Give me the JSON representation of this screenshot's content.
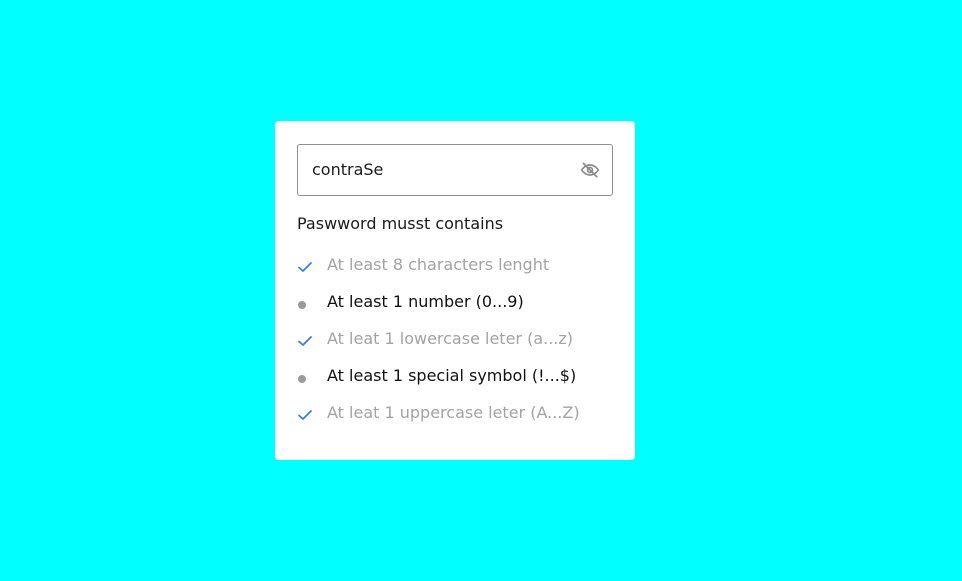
{
  "colors": {
    "background": "#00FFFF",
    "card": "#FFFFFF",
    "check": "#3B7DE8",
    "met_text": "#A3A3A3",
    "unmet_text": "#111111",
    "bullet": "#9A9A9A"
  },
  "password": {
    "value": "contraSe",
    "visibility_icon": "eye-off-icon"
  },
  "requirements": {
    "title": "Paswword musst contains",
    "items": [
      {
        "label": "At least 8 characters lenght",
        "met": true,
        "icon": "check-icon"
      },
      {
        "label": "At least 1 number (0...9)",
        "met": false,
        "icon": "bullet-icon"
      },
      {
        "label": "At leat 1 lowercase leter (a...z)",
        "met": true,
        "icon": "check-icon"
      },
      {
        "label": "At least 1 special symbol (!...$)",
        "met": false,
        "icon": "bullet-icon"
      },
      {
        "label": "At leat 1 uppercase leter (A...Z)",
        "met": true,
        "icon": "check-icon"
      }
    ]
  }
}
